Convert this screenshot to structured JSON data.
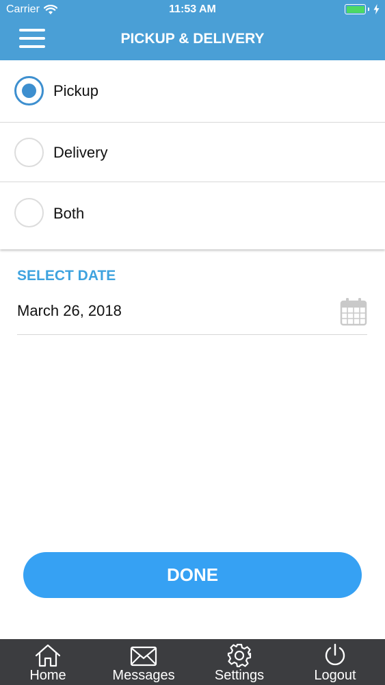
{
  "status_bar": {
    "carrier": "Carrier",
    "time": "11:53 AM",
    "battery_color": "#4cd964"
  },
  "header": {
    "title": "PICKUP & DELIVERY",
    "menu_icon": "hamburger-menu-icon",
    "background": "#4a9fd6"
  },
  "options": [
    {
      "label": "Pickup",
      "selected": true
    },
    {
      "label": "Delivery",
      "selected": false
    },
    {
      "label": "Both",
      "selected": false
    }
  ],
  "date_section": {
    "title": "SELECT DATE",
    "value": "March 26, 2018",
    "icon": "calendar-icon",
    "title_color": "#3fa3df"
  },
  "done_button": {
    "label": "DONE",
    "color": "#36a1f3"
  },
  "tabbar": {
    "background": "#3c3d40",
    "items": [
      {
        "label": "Home",
        "icon": "home-icon"
      },
      {
        "label": "Messages",
        "icon": "envelope-icon"
      },
      {
        "label": "Settings",
        "icon": "gear-icon"
      },
      {
        "label": "Logout",
        "icon": "power-icon"
      }
    ]
  }
}
